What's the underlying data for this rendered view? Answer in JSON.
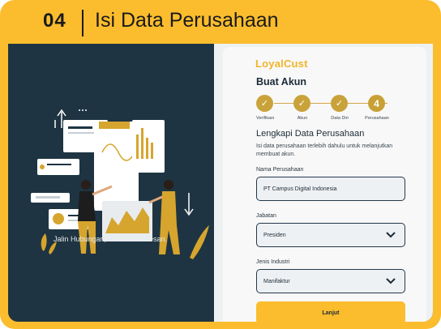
{
  "header": {
    "step_number": "04",
    "step_title": "Isi Data Perusahaan"
  },
  "left_panel": {
    "tagline": "Jalin Hubungan, Raih Kesuksesan."
  },
  "form": {
    "logo": "LoyalCust",
    "title": "Buat Akun",
    "steps": [
      {
        "label": "Verifikasi",
        "state": "done",
        "marker": "✓"
      },
      {
        "label": "Akun",
        "state": "done",
        "marker": "✓"
      },
      {
        "label": "Data Diri",
        "state": "done",
        "marker": "✓"
      },
      {
        "label": "Perusahaan",
        "state": "current",
        "marker": "4"
      }
    ],
    "section_title": "Lengkapi Data Perusahaan",
    "section_desc": "Isi data perusahaan terlebih dahulu untuk melanjutkan membuat akun.",
    "fields": {
      "company_name": {
        "label": "Nama Perusahaan",
        "value": "PT Campus Digital Indonesia"
      },
      "position": {
        "label": "Jabatan",
        "value": "Presiden"
      },
      "industry": {
        "label": "Jenis Industri",
        "value": "Manifaktur"
      }
    },
    "submit_label": "Lanjut"
  },
  "colors": {
    "accent": "#fbbd2e",
    "panel": "#1e3442",
    "step": "#c9a23a"
  }
}
